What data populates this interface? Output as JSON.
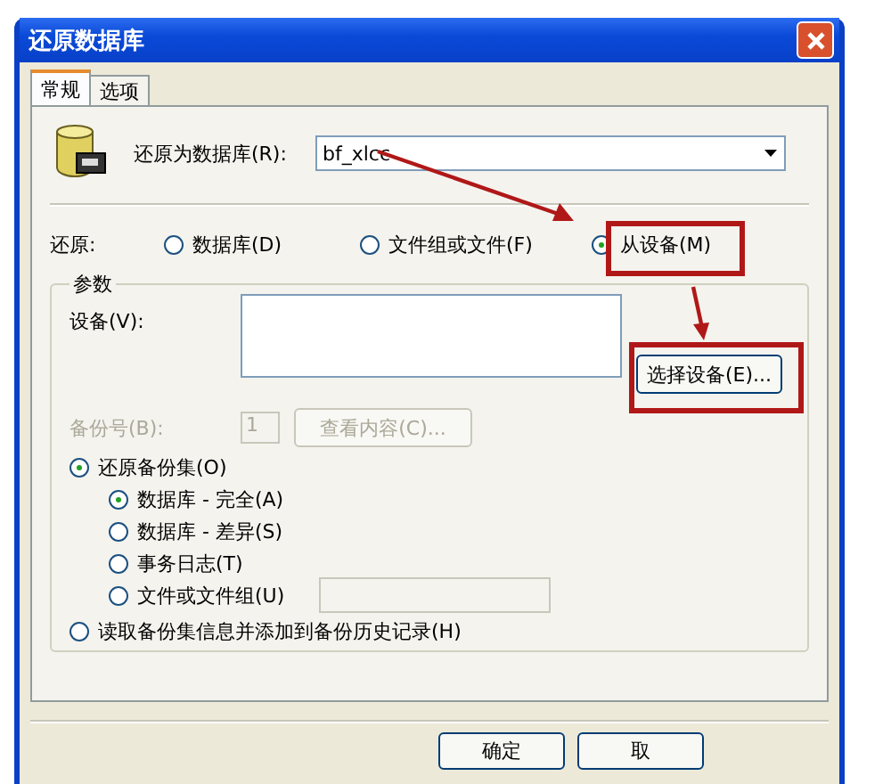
{
  "window": {
    "title": "还原数据库"
  },
  "tabs": [
    {
      "label": "常规",
      "selected": true
    },
    {
      "label": "选项",
      "selected": false
    }
  ],
  "restore_as": {
    "label": "还原为数据库(R):",
    "value": "bf_xlcc"
  },
  "restore": {
    "label": "还原:",
    "options": [
      {
        "label": "数据库(D)",
        "selected": false
      },
      {
        "label": "文件组或文件(F)",
        "selected": false
      },
      {
        "label": "从设备(M)",
        "selected": true
      }
    ]
  },
  "params": {
    "title": "参数",
    "device_label": "设备(V):",
    "select_device_button": "选择设备(E)...",
    "backup_no": {
      "label": "备份号(B):",
      "value": "1",
      "disabled": true
    },
    "view_contents_button": {
      "label": "查看内容(C)...",
      "disabled": true
    },
    "restore_set": {
      "label": "还原备份集(O)",
      "selected": true,
      "options": [
        {
          "label": "数据库 - 完全(A)",
          "selected": true,
          "kind": "radio"
        },
        {
          "label": "数据库 - 差异(S)",
          "selected": false,
          "kind": "radio"
        },
        {
          "label": "事务日志(T)",
          "selected": false,
          "kind": "radio"
        },
        {
          "label": "文件或文件组(U)",
          "selected": false,
          "kind": "radio-field"
        }
      ]
    },
    "read_info": {
      "label": "读取备份集信息并添加到备份历史记录(H)",
      "selected": false
    }
  },
  "buttons": [
    {
      "label": "确定"
    },
    {
      "label": "取"
    }
  ]
}
